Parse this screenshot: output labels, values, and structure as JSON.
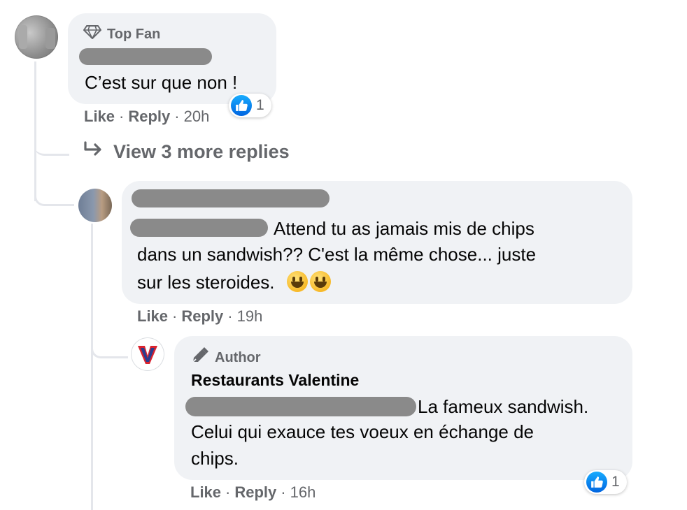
{
  "comment1": {
    "badge": "Top Fan",
    "text": "C’est sur que non !",
    "reaction_count": "1",
    "like_label": "Like",
    "reply_label": "Reply",
    "time": "20h"
  },
  "view_more": {
    "label": "View 3 more replies"
  },
  "comment2": {
    "text_line1": "Attend tu as jamais mis de chips",
    "text_line2": "dans un sandwish?? C'est la même chose... juste",
    "text_line3": "sur les steroides.",
    "like_label": "Like",
    "reply_label": "Reply",
    "time": "19h"
  },
  "comment3": {
    "badge": "Author",
    "author_name": "Restaurants Valentine",
    "avatar_letter": "V",
    "text_line1": "La fameux sandwish.",
    "text_line2": "Celui qui exauce tes voeux en échange de",
    "text_line3": "chips.",
    "reaction_count": "1",
    "like_label": "Like",
    "reply_label": "Reply",
    "time": "16h"
  },
  "colors": {
    "bubble": "#f0f2f5",
    "secondary_text": "#65676b",
    "like_blue": "#1877f2",
    "brand_red": "#d9232f",
    "brand_blue": "#2b3d8f"
  }
}
